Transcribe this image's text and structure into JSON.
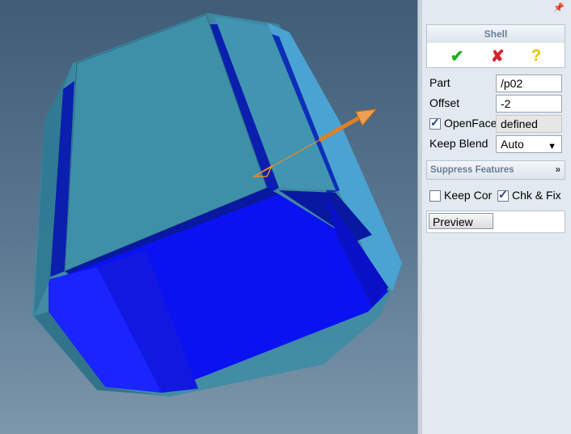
{
  "viewport": {
    "colors": {
      "bg_top": "#3f5d77",
      "bg_bottom": "#7d97ab",
      "face_light": "#3e8fa8",
      "face_dark": "#0d10f0",
      "manipulator": "#e88a2e"
    }
  },
  "panel": {
    "pin_icon": "pin-icon",
    "shell": {
      "title": "Shell",
      "ok_icon": "✔",
      "cancel_icon": "✘",
      "help_icon": "?",
      "part_label": "Part",
      "part_value": "/p02",
      "offset_label": "Offset",
      "offset_value": "-2",
      "openface_label": "OpenFace",
      "openface_checked": true,
      "openface_value": "defined",
      "keepblend_label": "Keep Blend",
      "keepblend_value": "Auto"
    },
    "suppress": {
      "title": "Suppress Features",
      "keep_label": "Keep Cor",
      "keep_checked": false,
      "chk_label": "Chk & Fix",
      "chk_checked": true
    },
    "preview_label": "Preview"
  }
}
